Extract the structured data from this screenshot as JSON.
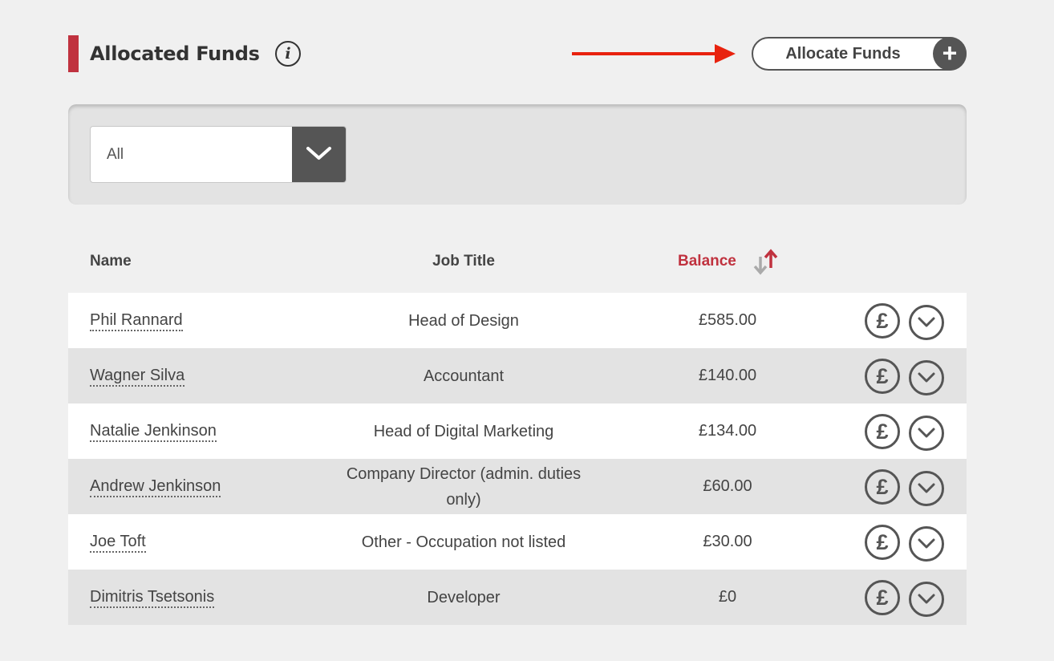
{
  "header": {
    "title": "Allocated Funds",
    "info_icon": "info-icon",
    "allocate_button_label": "Allocate Funds",
    "allocate_icon": "plus-icon"
  },
  "filter": {
    "selected": "All",
    "toggle_icon": "chevron-down-icon"
  },
  "table": {
    "columns": {
      "name": "Name",
      "job_title": "Job Title",
      "balance": "Balance"
    },
    "sort_icon": "sort-arrows-icon",
    "rows": [
      {
        "name": "Phil Rannard",
        "job_title": "Head of Design",
        "balance": "£585.00"
      },
      {
        "name": "Wagner Silva",
        "job_title": "Accountant",
        "balance": "£140.00"
      },
      {
        "name": "Natalie Jenkinson",
        "job_title": "Head of Digital Marketing",
        "balance": "£134.00"
      },
      {
        "name": "Andrew Jenkinson",
        "job_title": "Company Director (admin. duties only)",
        "balance": "£60.00"
      },
      {
        "name": "Joe Toft",
        "job_title": "Other - Occupation not listed",
        "balance": "£30.00"
      },
      {
        "name": "Dimitris Tsetsonis",
        "job_title": "Developer",
        "balance": "£0"
      }
    ],
    "row_actions": {
      "allocate_icon": "pound-icon",
      "expand_icon": "chevron-down-icon",
      "pound_symbol": "£"
    }
  },
  "colors": {
    "accent": "#c0323f",
    "annotation_arrow": "#e8220e",
    "dark_control": "#555555",
    "panel": "#e3e3e3",
    "background": "#f0f0f0"
  }
}
